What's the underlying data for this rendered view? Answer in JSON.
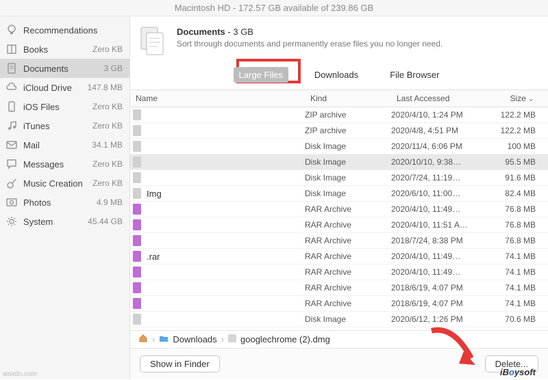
{
  "title": "Macintosh HD - 172.57 GB available of 239.86 GB",
  "sidebar": [
    {
      "icon": "lightbulb",
      "label": "Recommendations",
      "size": ""
    },
    {
      "icon": "book",
      "label": "Books",
      "size": "Zero KB"
    },
    {
      "icon": "doc",
      "label": "Documents",
      "size": "3 GB",
      "sel": true
    },
    {
      "icon": "cloud",
      "label": "iCloud Drive",
      "size": "147.8 MB"
    },
    {
      "icon": "phone",
      "label": "iOS Files",
      "size": "Zero KB"
    },
    {
      "icon": "music",
      "label": "iTunes",
      "size": "Zero KB"
    },
    {
      "icon": "mail",
      "label": "Mail",
      "size": "34.1 MB"
    },
    {
      "icon": "chat",
      "label": "Messages",
      "size": "Zero KB"
    },
    {
      "icon": "guitar",
      "label": "Music Creation",
      "size": "Zero KB"
    },
    {
      "icon": "photo",
      "label": "Photos",
      "size": "4.9 MB"
    },
    {
      "icon": "gear",
      "label": "System",
      "size": "45.44 GB"
    }
  ],
  "hdr": {
    "title_a": "Documents",
    "title_b": " - 3 GB",
    "sub": "Sort through documents and permanently erase files you no longer need."
  },
  "tabs": {
    "large": "Large Files",
    "downloads": "Downloads",
    "browser": "File Browser"
  },
  "cols": {
    "name": "Name",
    "kind": "Kind",
    "last": "Last Accessed",
    "size": "Size"
  },
  "rows": [
    {
      "c": "gray",
      "n": "",
      "k": "ZIP archive",
      "l": "2020/4/10, 1:24 PM",
      "s": "122.2 MB"
    },
    {
      "c": "gray",
      "n": "",
      "k": "ZIP archive",
      "l": "2020/4/8, 4:51 PM",
      "s": "122.2 MB"
    },
    {
      "c": "gray",
      "n": "",
      "k": "Disk Image",
      "l": "2020/11/4, 6:06 PM",
      "s": "100 MB"
    },
    {
      "c": "gray",
      "n": "",
      "k": "Disk Image",
      "l": "2020/10/10, 9:38…",
      "s": "95.5 MB",
      "sel": true
    },
    {
      "c": "gray",
      "n": "",
      "k": "Disk Image",
      "l": "2020/7/24, 11:19…",
      "s": "91.6 MB"
    },
    {
      "c": "gray",
      "n": "Img",
      "k": "Disk Image",
      "l": "2020/6/10, 11:00…",
      "s": "82.4 MB"
    },
    {
      "c": "purple",
      "n": "",
      "k": "RAR Archive",
      "l": "2020/4/10, 11:49…",
      "s": "76.8 MB"
    },
    {
      "c": "purple",
      "n": "",
      "k": "RAR Archive",
      "l": "2020/4/10, 11:51 A…",
      "s": "76.8 MB"
    },
    {
      "c": "purple",
      "n": "",
      "k": "RAR Archive",
      "l": "2018/7/24, 8:38 PM",
      "s": "76.8 MB"
    },
    {
      "c": "purple",
      "n": ".rar",
      "k": "RAR Archive",
      "l": "2020/4/10, 11:49…",
      "s": "74.1 MB"
    },
    {
      "c": "purple",
      "n": "",
      "k": "RAR Archive",
      "l": "2020/4/10, 11:49…",
      "s": "74.1 MB"
    },
    {
      "c": "purple",
      "n": "",
      "k": "RAR Archive",
      "l": "2018/6/19, 4:07 PM",
      "s": "74.1 MB"
    },
    {
      "c": "purple",
      "n": "",
      "k": "RAR Archive",
      "l": "2018/6/19, 4:07 PM",
      "s": "74.1 MB"
    },
    {
      "c": "gray",
      "n": "",
      "k": "Disk Image",
      "l": "2020/6/12, 1:26 PM",
      "s": "70.6 MB"
    }
  ],
  "bread": {
    "a": "",
    "b": "Downloads",
    "c": "googlechrome (2).dmg"
  },
  "btn": {
    "finder": "Show in Finder",
    "del": "Delete..."
  },
  "logo": {
    "a": "iB",
    "b": "o",
    "c": "ysoft"
  },
  "wm": "wsxdn.com"
}
